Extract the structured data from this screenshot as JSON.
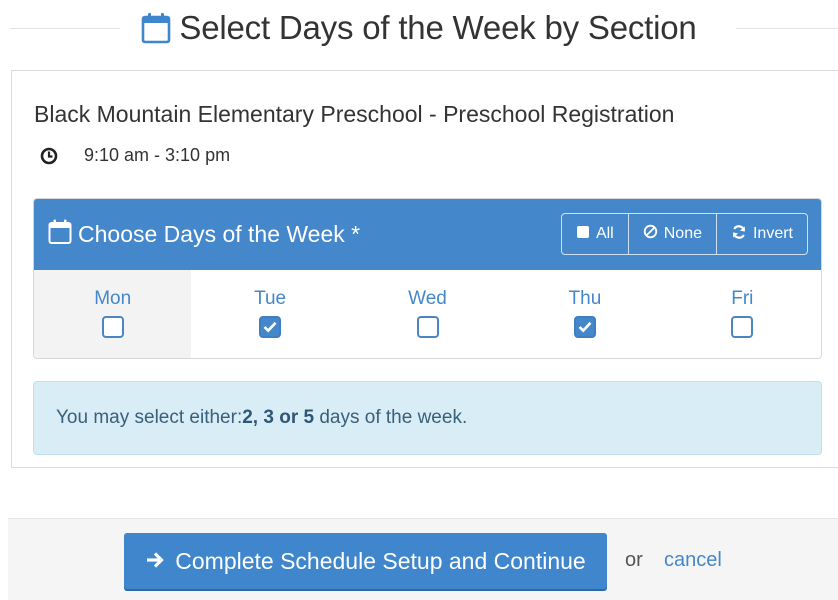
{
  "page": {
    "title": "Select Days of the Week by Section",
    "title_icon": "calendar-icon"
  },
  "section": {
    "name": "Black Mountain Elementary Preschool - Preschool Registration",
    "time": "9:10 am - 3:10 pm",
    "time_icon": "clock-icon"
  },
  "days_panel": {
    "heading": "Choose Days of the Week *",
    "heading_icon": "calendar-icon",
    "buttons": {
      "all": "All",
      "none": "None",
      "invert": "Invert"
    },
    "days": [
      {
        "label": "Mon",
        "checked": false
      },
      {
        "label": "Tue",
        "checked": true
      },
      {
        "label": "Wed",
        "checked": false
      },
      {
        "label": "Thu",
        "checked": true
      },
      {
        "label": "Fri",
        "checked": false
      }
    ]
  },
  "info": {
    "prefix": "You may select either: ",
    "options": "2, 3",
    "or_word": " or ",
    "last_option": "5",
    "suffix": " days of the week."
  },
  "footer": {
    "continue_label": "Complete Schedule Setup and Continue",
    "or_text": "or",
    "cancel_label": "cancel"
  },
  "colors": {
    "accent": "#4487cb",
    "info_bg": "#d9edf7",
    "info_text": "#3a5f78"
  }
}
